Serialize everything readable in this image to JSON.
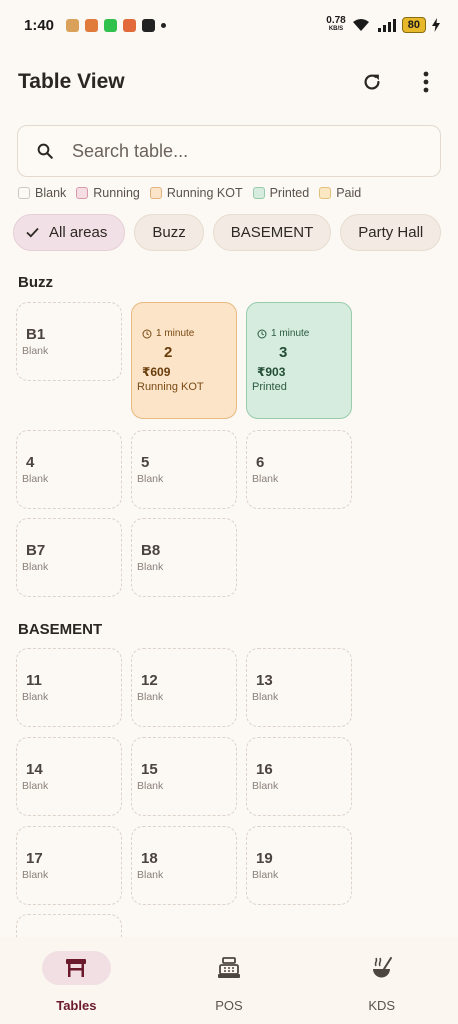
{
  "statusbar": {
    "time": "1:40",
    "net_speed": "0.78",
    "net_unit": "KB/S",
    "battery": "80"
  },
  "appbar": {
    "title": "Table View",
    "refresh_icon": "refresh-icon",
    "menu_icon": "more-vert-icon"
  },
  "search": {
    "placeholder": "Search table..."
  },
  "legend": [
    {
      "label": "Blank",
      "fill": "#fcf8f3",
      "border": "#cfc6bf"
    },
    {
      "label": "Running",
      "fill": "#f6dde4",
      "border": "#d79aaa"
    },
    {
      "label": "Running KOT",
      "fill": "#fbe4c8",
      "border": "#e3b17a"
    },
    {
      "label": "Printed",
      "fill": "#d6ecdf",
      "border": "#98cbac"
    },
    {
      "label": "Paid",
      "fill": "#fbe7c2",
      "border": "#e3c17a"
    }
  ],
  "areas": [
    {
      "label": "All areas",
      "selected": true
    },
    {
      "label": "Buzz",
      "selected": false
    },
    {
      "label": "BASEMENT",
      "selected": false
    },
    {
      "label": "Party Hall",
      "selected": false
    }
  ],
  "sections": [
    {
      "title": "Buzz",
      "tables": [
        {
          "name": "B1",
          "status": "Blank"
        },
        {
          "name": "2",
          "status": "Running KOT",
          "time": "1 minute",
          "amount": "₹609"
        },
        {
          "name": "3",
          "status": "Printed",
          "time": "1 minute",
          "amount": "₹903"
        },
        {
          "name": "4",
          "status": "Blank"
        },
        {
          "name": "5",
          "status": "Blank"
        },
        {
          "name": "6",
          "status": "Blank"
        },
        {
          "name": "B7",
          "status": "Blank"
        },
        {
          "name": "B8",
          "status": "Blank"
        }
      ]
    },
    {
      "title": "BASEMENT",
      "tables": [
        {
          "name": "11",
          "status": "Blank"
        },
        {
          "name": "12",
          "status": "Blank"
        },
        {
          "name": "13",
          "status": "Blank"
        },
        {
          "name": "14",
          "status": "Blank"
        },
        {
          "name": "15",
          "status": "Blank"
        },
        {
          "name": "16",
          "status": "Blank"
        },
        {
          "name": "17",
          "status": "Blank"
        },
        {
          "name": "18",
          "status": "Blank"
        },
        {
          "name": "19",
          "status": "Blank"
        }
      ]
    }
  ],
  "bottom_nav": [
    {
      "label": "Tables",
      "icon": "table-icon",
      "active": true
    },
    {
      "label": "POS",
      "icon": "cash-register-icon",
      "active": false
    },
    {
      "label": "KDS",
      "icon": "cooking-pot-icon",
      "active": false
    }
  ],
  "colors": {
    "accent": "#6b1a2b",
    "background": "#fcf8f3"
  }
}
